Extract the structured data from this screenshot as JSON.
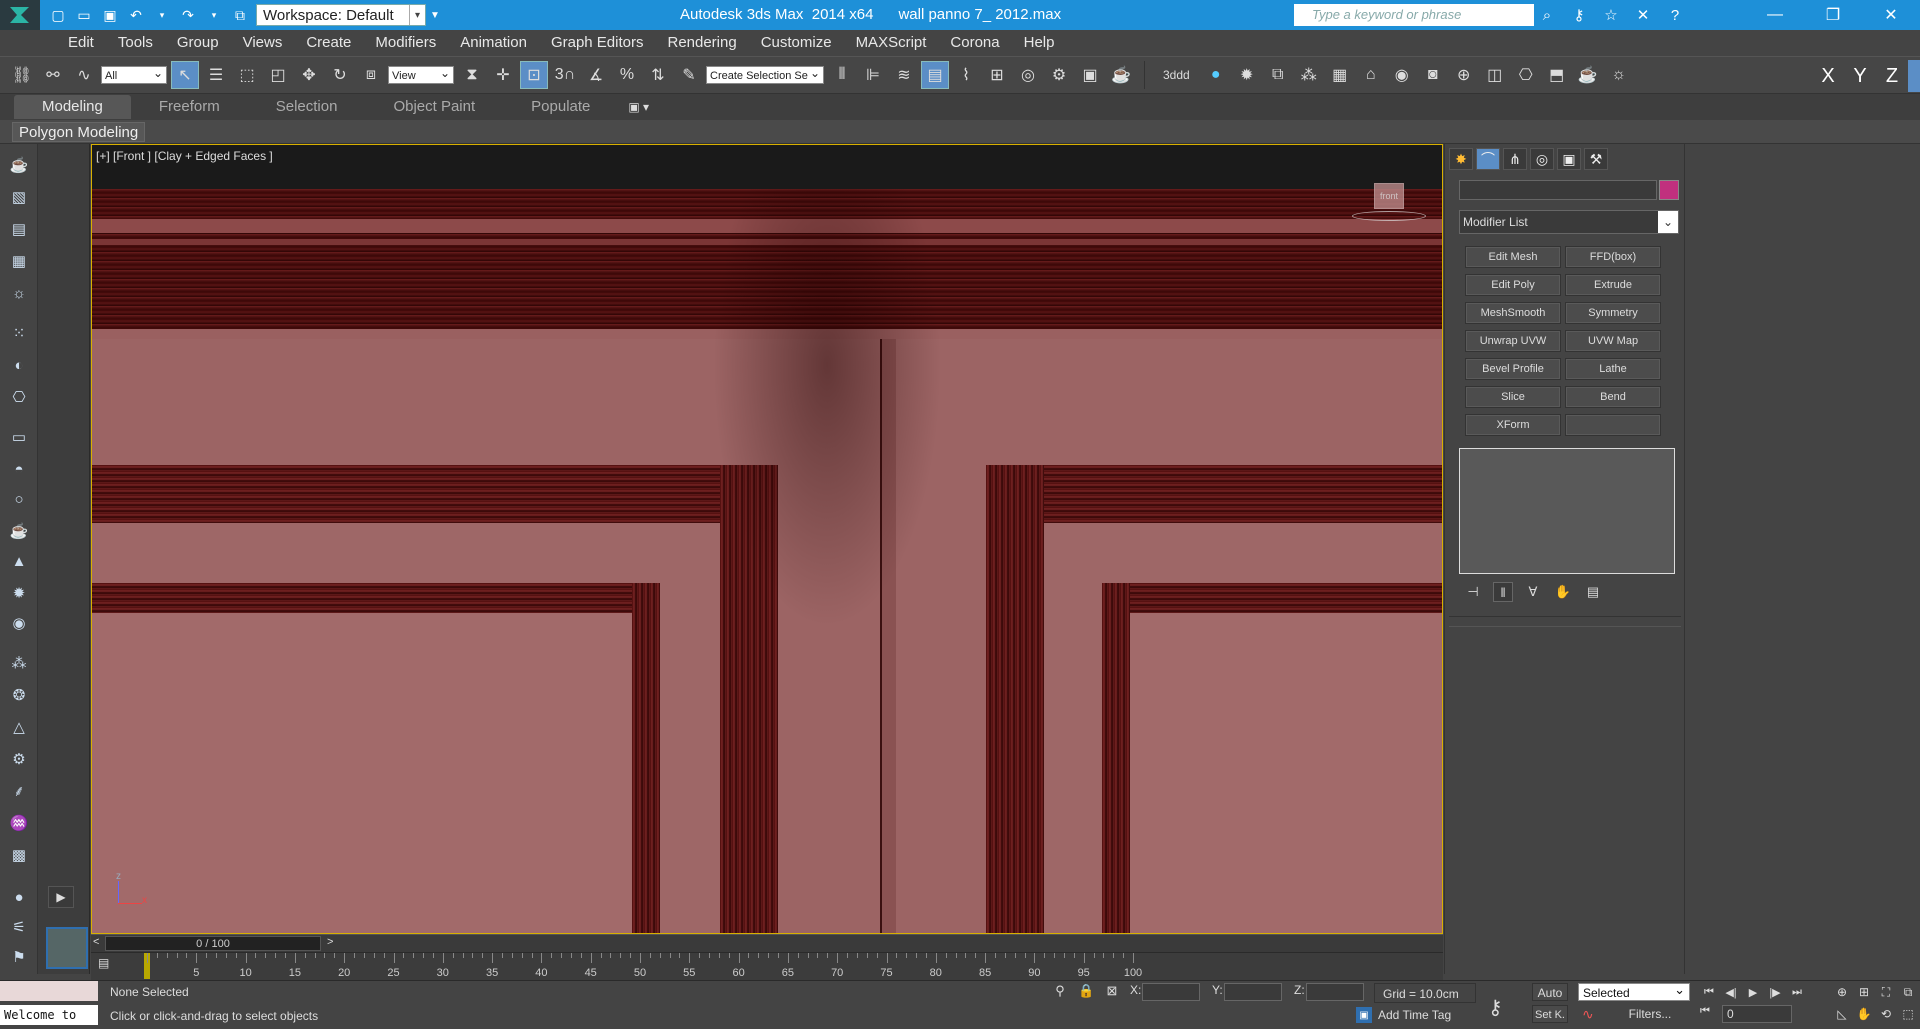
{
  "titlebar": {
    "workspace_label": "Workspace: Default",
    "title": "Autodesk 3ds Max  2014 x64      wall panno 7_ 2012.max",
    "search_placeholder": "Type a keyword or phrase",
    "icons": [
      "new-icon",
      "open-icon",
      "save-icon",
      "undo-icon",
      "redo-icon",
      "project-icon"
    ],
    "window_controls": [
      "minimize",
      "maximize",
      "close"
    ]
  },
  "menu": [
    "Edit",
    "Tools",
    "Group",
    "Views",
    "Create",
    "Modifiers",
    "Animation",
    "Graph Editors",
    "Rendering",
    "Customize",
    "MAXScript",
    "Corona",
    "Help"
  ],
  "main_toolbar": {
    "selection_filter": "All",
    "ref_coord": "View",
    "snap_label": "3",
    "named_selection_placeholder": "Create Selection Se",
    "text_3dddd": "3ddd",
    "axis_buttons": [
      "X",
      "Y",
      "Z"
    ]
  },
  "ribbon": {
    "tabs": [
      "Modeling",
      "Freeform",
      "Selection",
      "Object Paint",
      "Populate"
    ],
    "active_tab": "Modeling",
    "panel_label": "Polygon Modeling"
  },
  "viewport": {
    "label": "[+] [Front ] [Clay + Edged Faces ]",
    "gizmo_label": "front",
    "axis_z": "z",
    "axis_x": "x"
  },
  "command_panel": {
    "modifier_list_label": "Modifier List",
    "object_color": "#c0307e",
    "modifier_buttons": [
      "Edit Mesh",
      "FFD(box)",
      "Edit Poly",
      "Extrude",
      "MeshSmooth",
      "Symmetry",
      "Unwrap UVW",
      "UVW Map",
      "Bevel Profile",
      "Lathe",
      "Slice",
      "Bend",
      "XForm",
      ""
    ]
  },
  "timeline": {
    "frame_display": "0 / 100",
    "ticks": [
      5,
      10,
      15,
      20,
      25,
      30,
      35,
      40,
      45,
      50,
      55,
      60,
      65,
      70,
      75,
      80,
      85,
      90,
      95,
      100
    ]
  },
  "status": {
    "maxscript_text": "Welcome to",
    "selection_info": "None Selected",
    "prompt": "Click or click-and-drag to select objects",
    "x_label": "X:",
    "y_label": "Y:",
    "z_label": "Z:",
    "grid": "Grid = 10.0cm",
    "add_time_tag": "Add Time Tag",
    "auto_label": "Auto",
    "setk_label": "Set K.",
    "selected_label": "Selected",
    "filters_label": "Filters...",
    "frame_value": "0"
  }
}
